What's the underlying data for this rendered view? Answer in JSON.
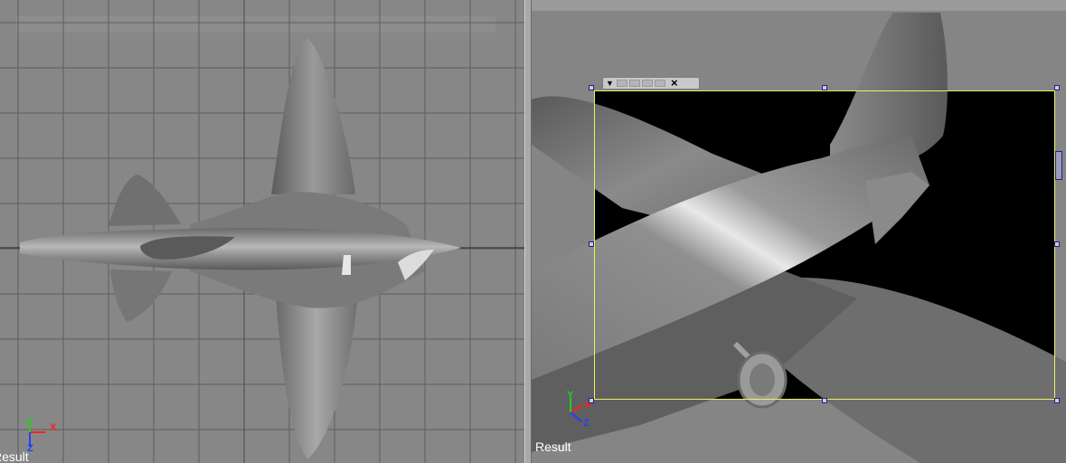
{
  "viewports": {
    "left": {
      "label": "Result",
      "axes": {
        "y": "Y",
        "x": "X",
        "z": "Z"
      },
      "colors": {
        "grid": "#5d5d5d",
        "background": "#878787",
        "x_axis": "#ff2020",
        "y_axis": "#20d020",
        "z_axis": "#2040ff"
      }
    },
    "right": {
      "label": "Result",
      "axes": {
        "y": "Y",
        "x": "X",
        "z": "Z"
      },
      "render_region": {
        "toolbar_icons": [
          "dropdown-arrow-icon",
          "region-button",
          "region-button",
          "region-button",
          "region-button",
          "close-icon"
        ],
        "close_glyph": "×",
        "arrow_glyph": "▼",
        "frame_color": "#f0f060",
        "handle_color": "#22227a"
      }
    }
  }
}
